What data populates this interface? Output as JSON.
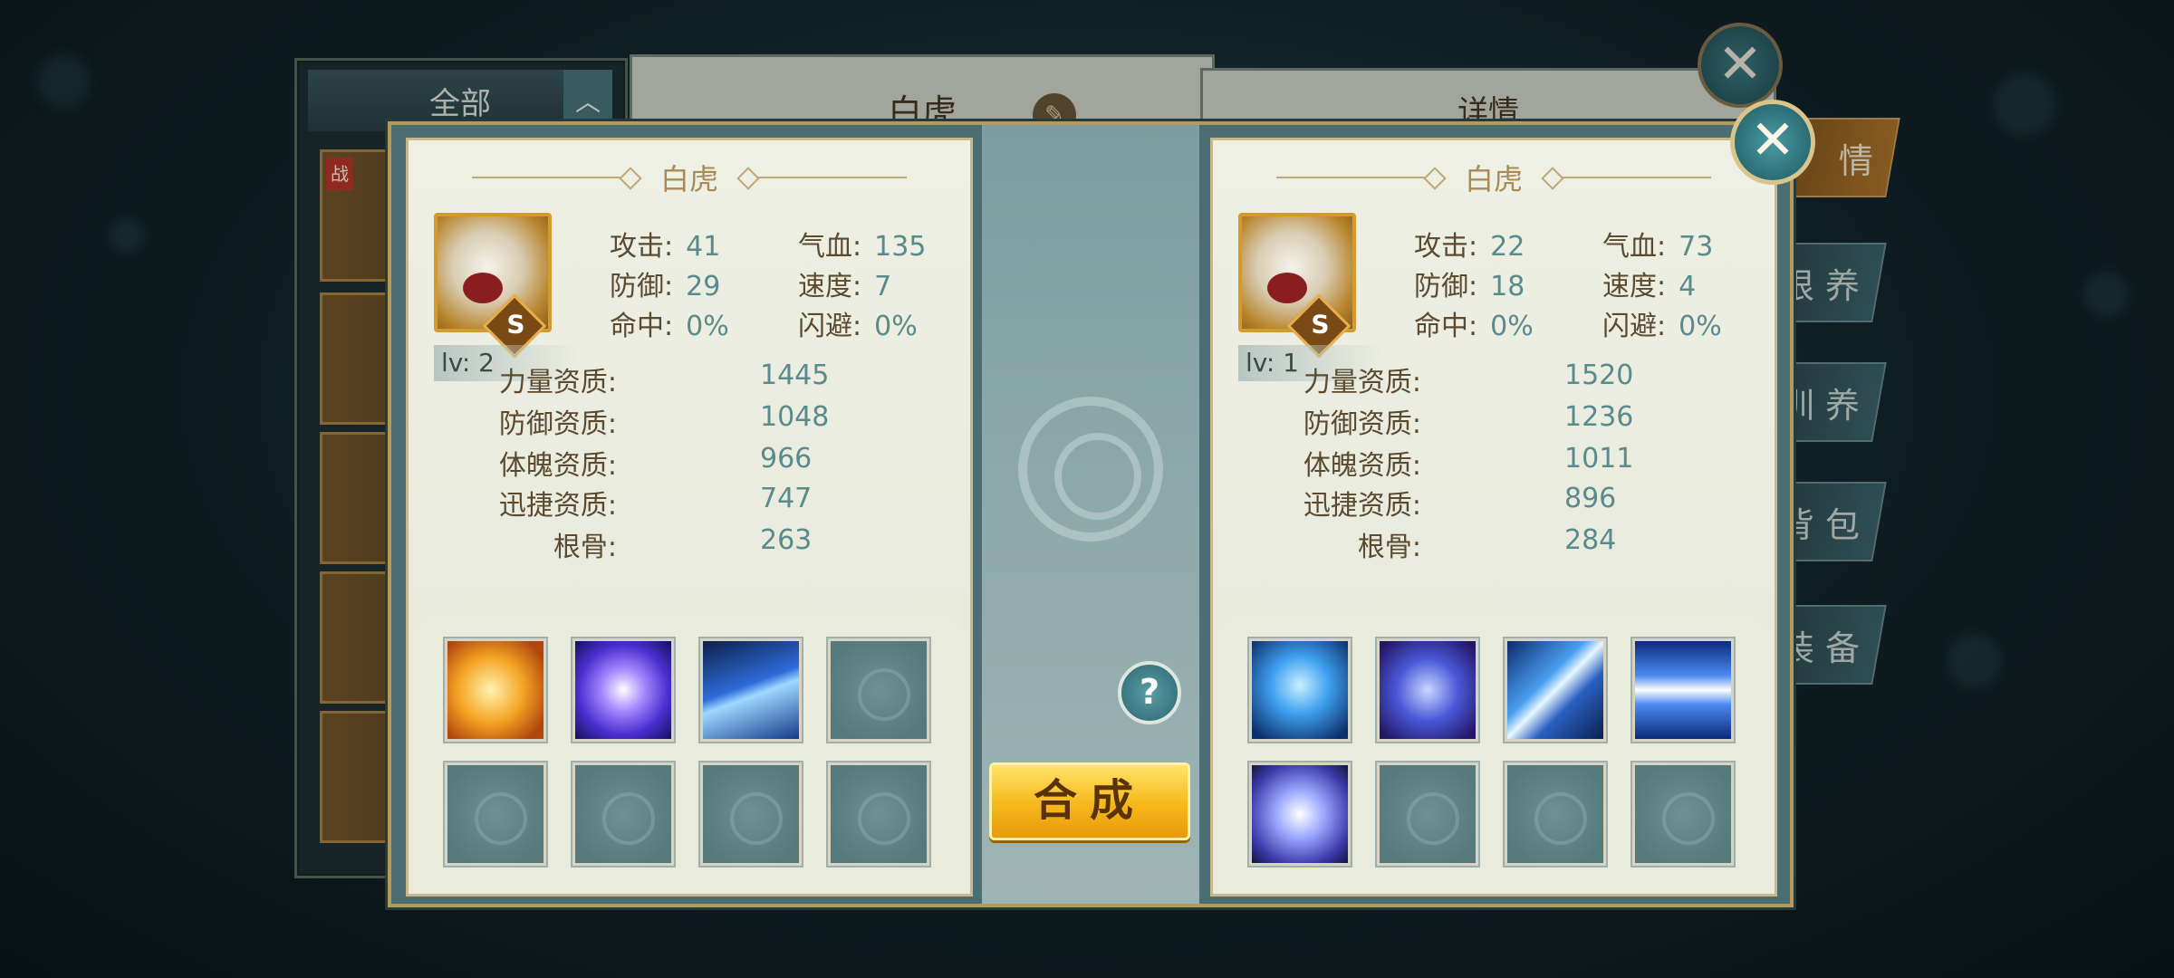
{
  "background": {
    "list_header": "全部",
    "middle_title": "白虎",
    "right_title": "详情",
    "side_tabs": [
      "情",
      "根 养",
      "训 养",
      "背 包",
      "装 备"
    ],
    "card_tag": "战"
  },
  "left_pet": {
    "name": "白虎",
    "rank": "S",
    "level": "lv: 2",
    "stats": {
      "attack_label": "攻击:",
      "attack": "41",
      "hp_label": "气血:",
      "hp": "135",
      "defense_label": "防御:",
      "defense": "29",
      "speed_label": "速度:",
      "speed": "7",
      "hit_label": "命中:",
      "hit": "0%",
      "dodge_label": "闪避:",
      "dodge": "0%"
    },
    "aptitudes": {
      "strength_label": "力量资质:",
      "strength": "1445",
      "defense_label": "防御资质:",
      "defense": "1048",
      "physique_label": "体魄资质:",
      "physique": "966",
      "agility_label": "迅捷资质:",
      "agility": "747",
      "bone_label": "根骨:",
      "bone": "263"
    },
    "skills": [
      "fire-tiger-skill-icon",
      "lightning-orb-skill-icon",
      "ice-shards-skill-icon",
      "empty",
      "empty",
      "empty",
      "empty",
      "empty"
    ]
  },
  "right_pet": {
    "name": "白虎",
    "rank": "S",
    "level": "lv: 1",
    "stats": {
      "attack_label": "攻击:",
      "attack": "22",
      "hp_label": "气血:",
      "hp": "73",
      "defense_label": "防御:",
      "defense": "18",
      "speed_label": "速度:",
      "speed": "4",
      "hit_label": "命中:",
      "hit": "0%",
      "dodge_label": "闪避:",
      "dodge": "0%"
    },
    "aptitudes": {
      "strength_label": "力量资质:",
      "strength": "1520",
      "defense_label": "防御资质:",
      "defense": "1236",
      "physique_label": "体魄资质:",
      "physique": "1011",
      "agility_label": "迅捷资质:",
      "agility": "896",
      "bone_label": "根骨:",
      "bone": "284"
    },
    "skills": [
      "water-heart-skill-icon",
      "shield-skill-icon",
      "lightning-bolt-skill-icon",
      "dash-skill-icon",
      "swirl-skill-icon",
      "empty",
      "empty",
      "empty"
    ]
  },
  "actions": {
    "help": "?",
    "compose": "合成",
    "close": "✕"
  }
}
